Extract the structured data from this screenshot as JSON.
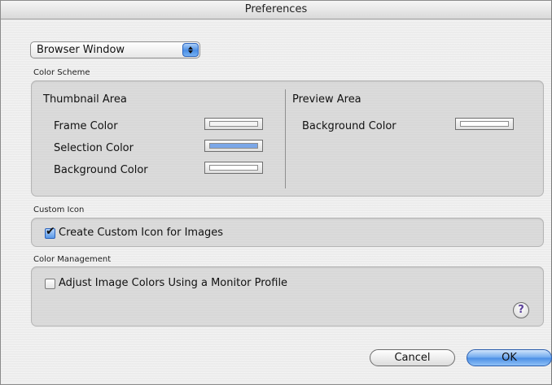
{
  "window": {
    "title": "Preferences"
  },
  "popup": {
    "selected": "Browser Window"
  },
  "color_scheme": {
    "label": "Color Scheme",
    "thumbnail": {
      "heading": "Thumbnail Area",
      "rows": [
        {
          "label": "Frame Color",
          "color": "#f4f4f4"
        },
        {
          "label": "Selection Color",
          "color": "#7ba7e8"
        },
        {
          "label": "Background Color",
          "color": "#ffffff"
        }
      ]
    },
    "preview": {
      "heading": "Preview Area",
      "rows": [
        {
          "label": "Background Color",
          "color": "#ffffff"
        }
      ]
    }
  },
  "custom_icon": {
    "label": "Custom Icon",
    "checkbox_label": "Create Custom Icon for Images",
    "checked": true
  },
  "color_management": {
    "label": "Color Management",
    "checkbox_label": "Adjust Image Colors Using a Monitor Profile",
    "checked": false
  },
  "help": {
    "icon": "help-icon",
    "glyph": "?"
  },
  "buttons": {
    "cancel": "Cancel",
    "ok": "OK"
  },
  "colors": {
    "accent": "#4b8ee5"
  }
}
